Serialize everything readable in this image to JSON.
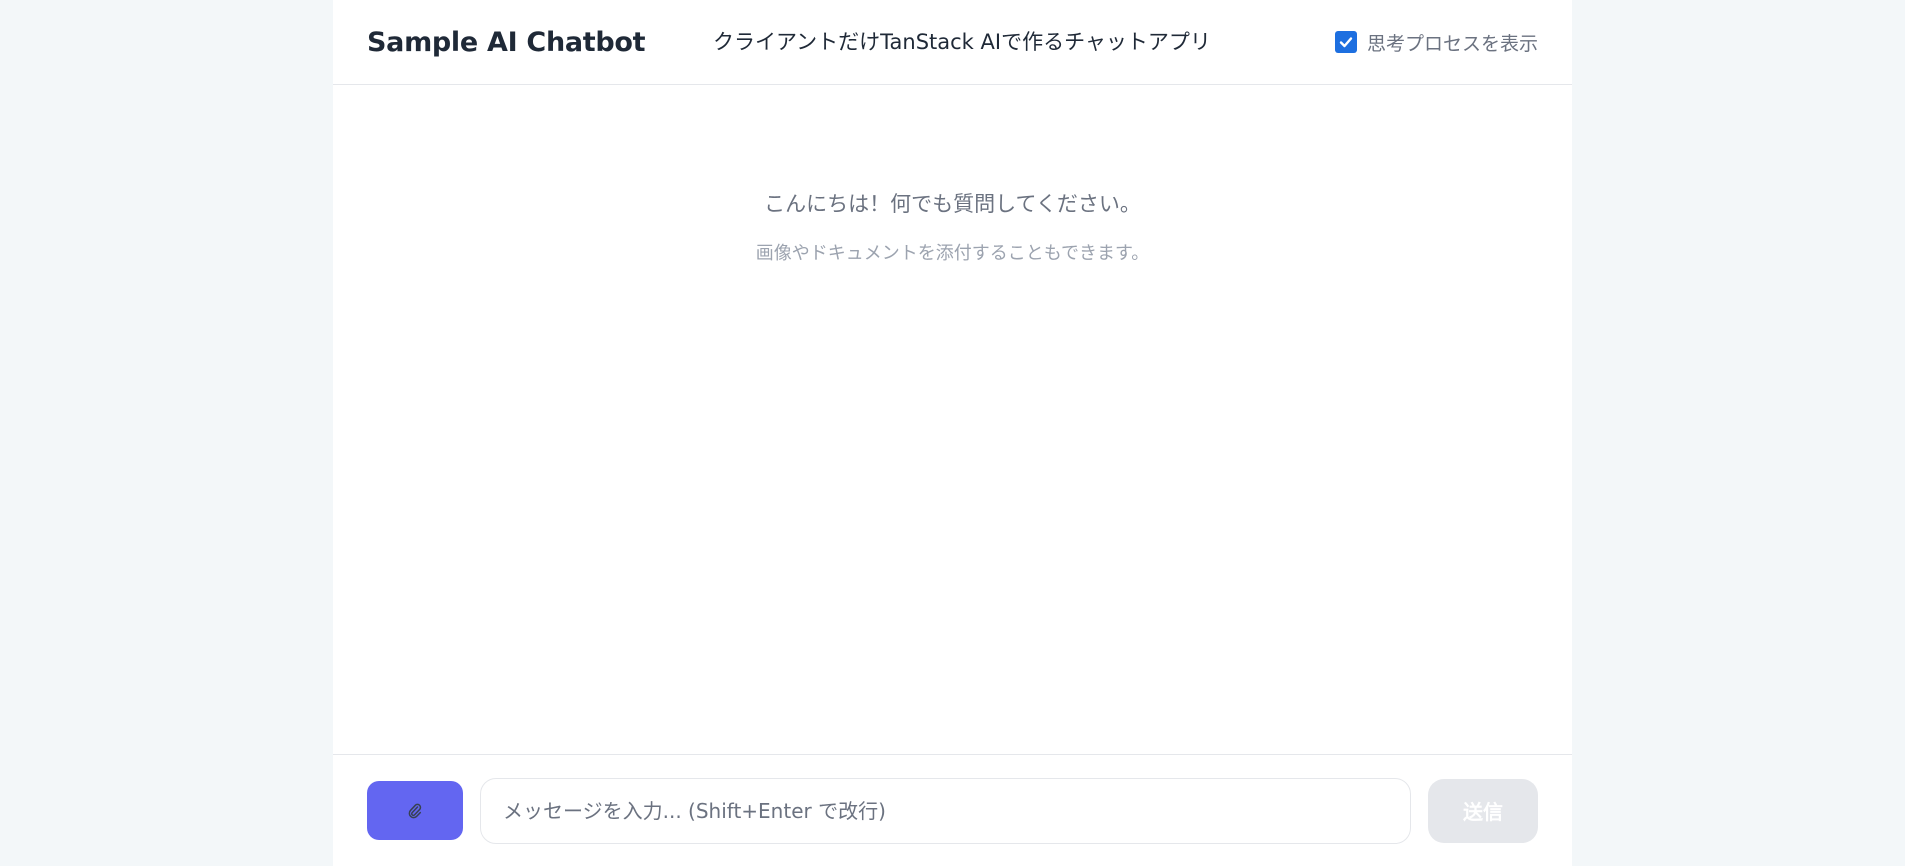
{
  "header": {
    "title": "Sample AI Chatbot",
    "subtitle": "クライアントだけTanStack AIで作るチャットアプリ",
    "thinking_toggle": {
      "label": "思考プロセスを表示",
      "checked": true
    }
  },
  "welcome": {
    "title": "こんにちは！何でも質問してください。",
    "subtitle": "画像やドキュメントを添付することもできます。"
  },
  "composer": {
    "attach_icon": "paperclip-icon",
    "input_placeholder": "メッセージを入力... (Shift+Enter で改行)",
    "input_value": "",
    "send_label": "送信"
  },
  "colors": {
    "accent": "#6366f1",
    "checkbox": "#1d6fe0",
    "background": "#f3f7f9"
  }
}
